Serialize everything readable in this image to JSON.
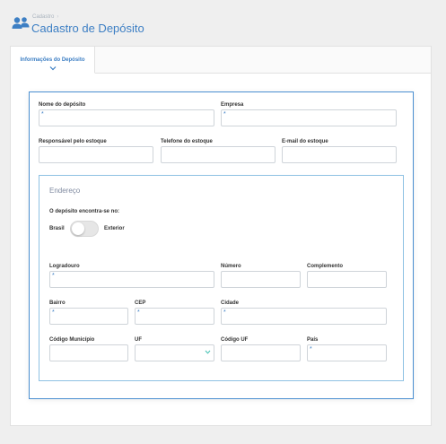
{
  "breadcrumb": {
    "parent": "Cadastro",
    "separator": "›"
  },
  "page": {
    "title": "Cadastro de Depósito"
  },
  "tabs": [
    {
      "label": "Informações do Depósito"
    }
  ],
  "form": {
    "required_mark": "*",
    "nome_deposito": {
      "label": "Nome do depósito",
      "value": ""
    },
    "empresa": {
      "label": "Empresa",
      "value": ""
    },
    "responsavel": {
      "label": "Responsável pelo estoque",
      "value": ""
    },
    "telefone": {
      "label": "Telefone do estoque",
      "value": ""
    },
    "email": {
      "label": "E-mail do estoque",
      "value": ""
    }
  },
  "endereco": {
    "title": "Endereço",
    "location_question": "O depósito encontra-se no:",
    "option_left": "Brasil",
    "option_right": "Exterior",
    "toggle_exterior": false,
    "logradouro": {
      "label": "Logradouro",
      "value": ""
    },
    "numero": {
      "label": "Número",
      "value": ""
    },
    "complemento": {
      "label": "Complemento",
      "value": ""
    },
    "bairro": {
      "label": "Bairro",
      "value": ""
    },
    "cep": {
      "label": "CEP",
      "value": ""
    },
    "cidade": {
      "label": "Cidade",
      "value": ""
    },
    "codigo_municipio": {
      "label": "Código Município",
      "value": ""
    },
    "uf": {
      "label": "UF",
      "value": ""
    },
    "codigo_uf": {
      "label": "Código UF",
      "value": ""
    },
    "pais": {
      "label": "País",
      "value": ""
    }
  },
  "colors": {
    "accent": "#3d7fc4",
    "border_blue": "#4a8fd1",
    "section_border": "#8ec1e3",
    "background": "#efefef"
  },
  "icons": {
    "header": "users-icon",
    "tab": "chevron-down-icon",
    "uf_select": "chevron-down-icon"
  }
}
